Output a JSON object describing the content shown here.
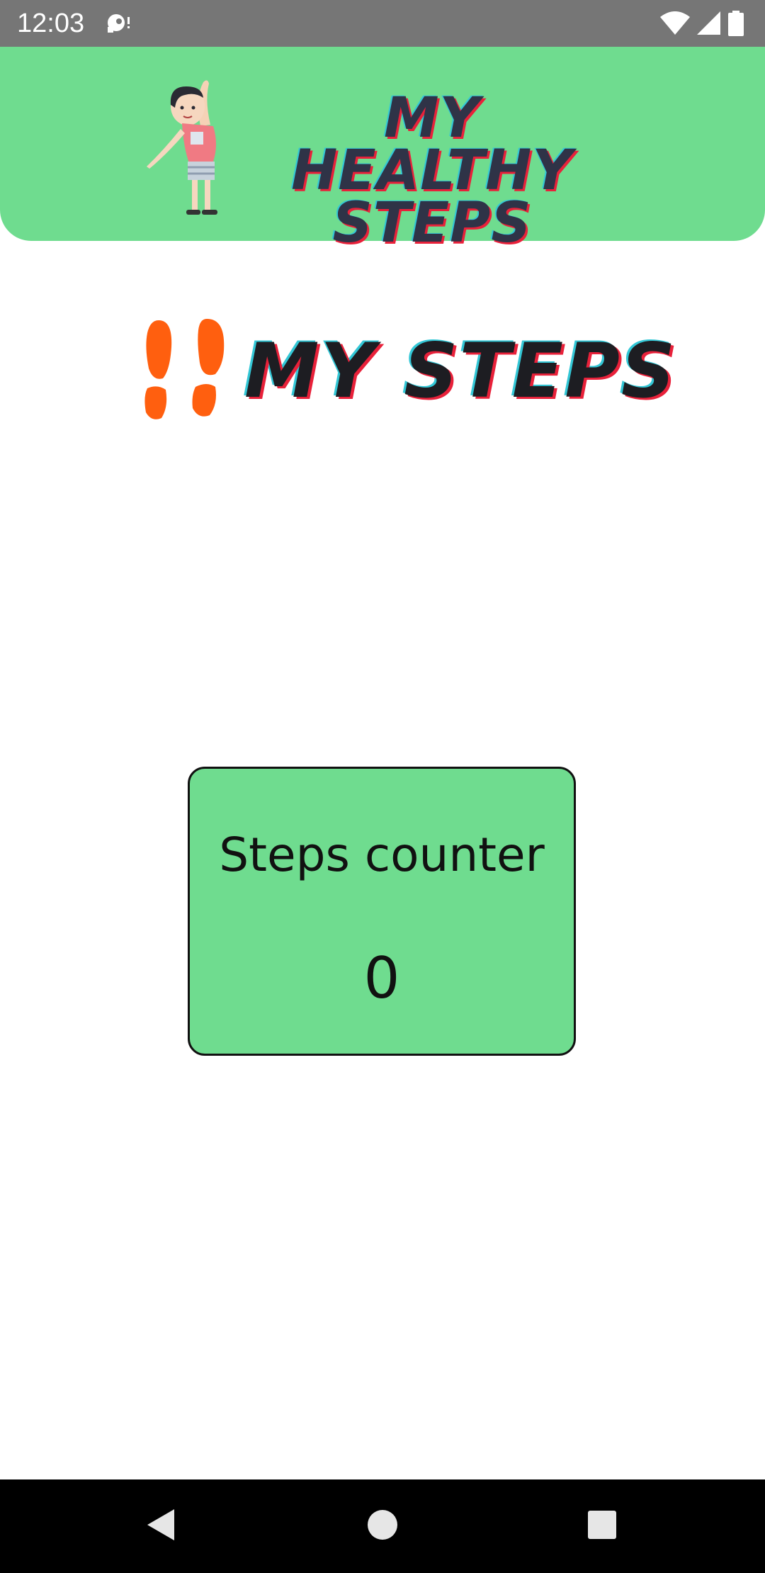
{
  "status_bar": {
    "time": "12:03",
    "left_icon": "notification-icon",
    "right_icons": [
      "wifi-icon",
      "cellular-signal-icon",
      "battery-icon"
    ]
  },
  "header": {
    "logo_line1": "MY HEALTHY",
    "logo_line2": "STEPS",
    "mascot_icon": "stretching-kid-icon",
    "background_color": "#6fdc8f"
  },
  "section": {
    "title": "MY STEPS",
    "icon": "footprints-icon",
    "icon_color": "#ff5f0f"
  },
  "counter": {
    "label": "Steps counter",
    "value": "0",
    "background_color": "#6fdc8f"
  },
  "nav_bar": {
    "buttons": [
      "back-icon",
      "home-icon",
      "recents-icon"
    ]
  }
}
